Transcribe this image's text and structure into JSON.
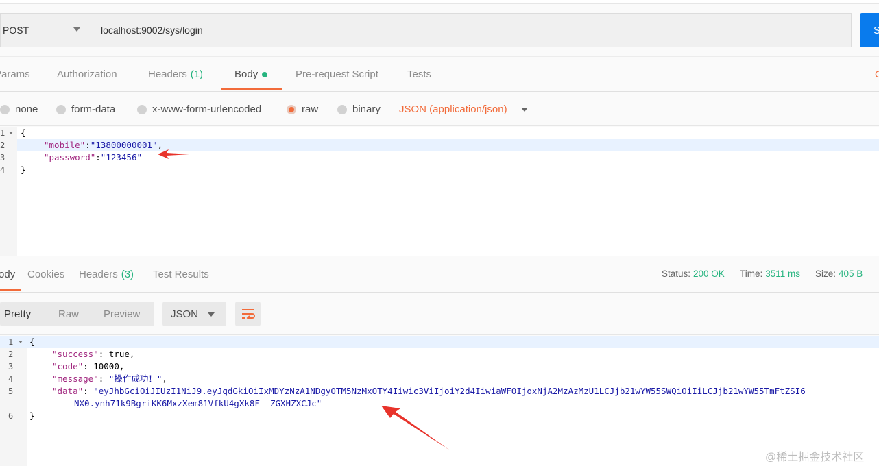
{
  "request": {
    "method": "POST",
    "url": "localhost:9002/sys/login",
    "send_label": "S"
  },
  "request_tabs": {
    "params": "Params",
    "authorization": "Authorization",
    "headers": "Headers",
    "headers_count": "(1)",
    "body": "Body",
    "prerequest": "Pre-request Script",
    "tests": "Tests",
    "cookies_cut": "C"
  },
  "body_types": {
    "none": "none",
    "form_data": "form-data",
    "urlencoded": "x-www-form-urlencoded",
    "raw": "raw",
    "binary": "binary",
    "content_type": "JSON (application/json)",
    "selected": "raw"
  },
  "request_body": {
    "line_numbers": [
      "1",
      "2",
      "3",
      "4"
    ],
    "open": "{",
    "mobile_key": "\"mobile\"",
    "mobile_val": "\"13800000001\"",
    "password_key": "\"password\"",
    "password_val": "\"123456\"",
    "close": "}"
  },
  "response_tabs": {
    "body": "Body",
    "cookies": "Cookies",
    "headers": "Headers",
    "headers_count": "(3)",
    "test_results": "Test Results"
  },
  "status": {
    "status_label": "Status:",
    "status_value": "200 OK",
    "time_label": "Time:",
    "time_value": "3511 ms",
    "size_label": "Size:",
    "size_value": "405 B"
  },
  "response_toolbar": {
    "pretty": "Pretty",
    "raw": "Raw",
    "preview": "Preview",
    "format": "JSON"
  },
  "response_body": {
    "line_numbers": [
      "1",
      "2",
      "3",
      "4",
      "5",
      "",
      "6"
    ],
    "open": "{",
    "success_key": "\"success\"",
    "success_val": "true",
    "code_key": "\"code\"",
    "code_val": "10000",
    "message_key": "\"message\"",
    "message_val": "\"操作成功！\"",
    "data_key": "\"data\"",
    "data_val_line1": "\"eyJhbGciOiJIUzI1NiJ9.eyJqdGkiOiIxMDYzNzA1NDgyOTM5NzMxOTY4Iiwic3ViIjoiY2d4IiwiaWF0IjoxNjA2MzAzMzU1LCJjb21wYW55SWQiOiIiLCJjb21wYW55TmFtZSI6",
    "data_val_line2": "NX0.ynh71k9BgriKK6MxzXem81VfkU4gXk8F_-ZGXHZXCJc\"",
    "close": "}"
  },
  "watermark": "@稀土掘金技术社区",
  "colors": {
    "accent": "#f26b3a",
    "success": "#26b47f",
    "send_button": "#097bed",
    "json_key": "#a1277f",
    "json_string": "#1a1aa6",
    "annotation_arrow": "#e8332b"
  }
}
